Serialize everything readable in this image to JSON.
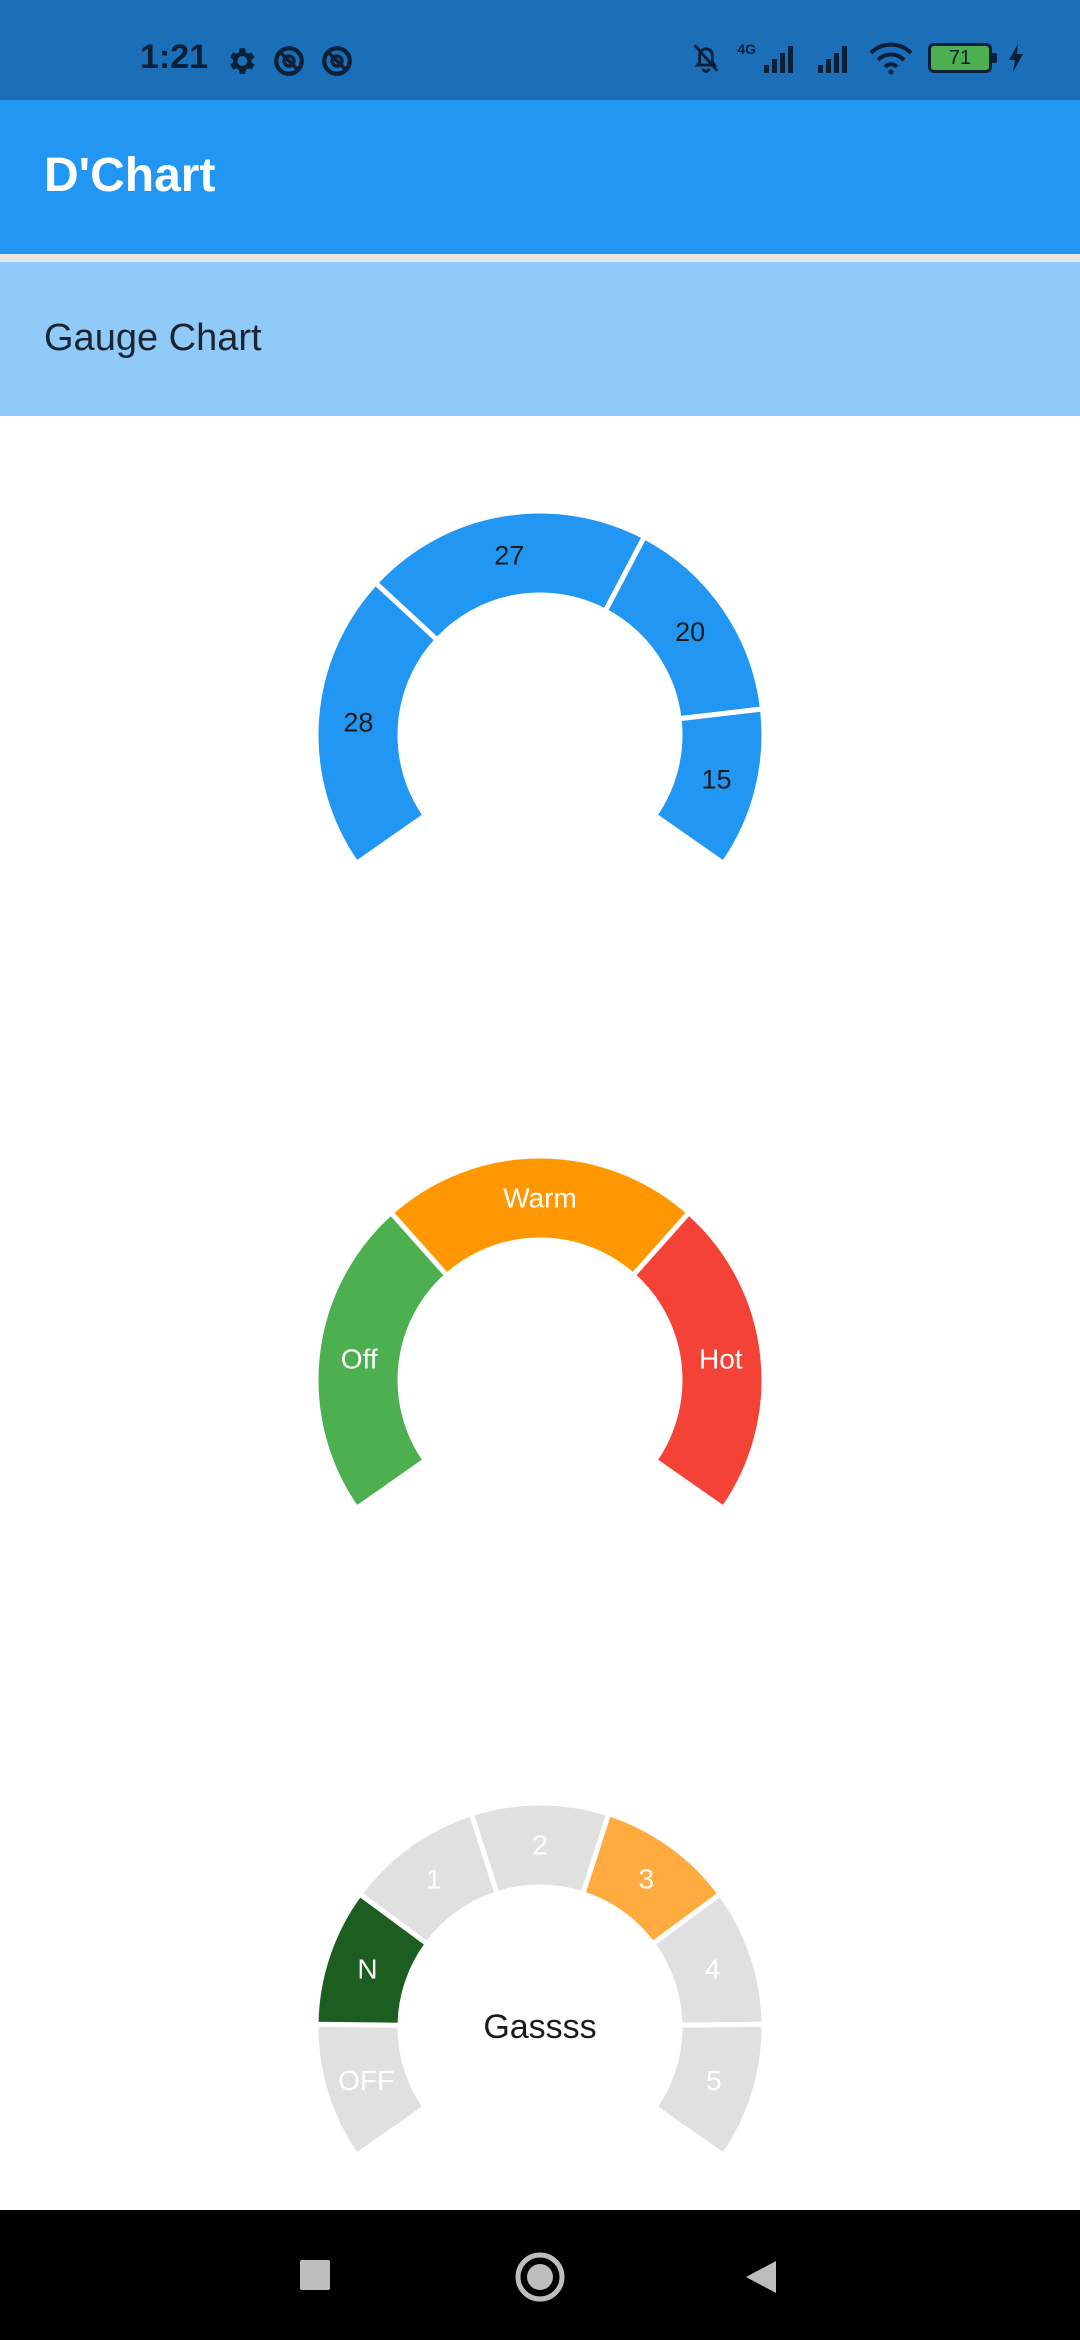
{
  "status_bar": {
    "time": "1:21",
    "battery_level": "71",
    "network_label": "4G",
    "icons": [
      "settings-icon",
      "sync-off-icon",
      "sync-off-icon",
      "mute-bell-icon",
      "signal-icon",
      "signal-icon",
      "wifi-icon",
      "battery-icon",
      "charging-icon"
    ]
  },
  "app_bar": {
    "title": "D'Chart"
  },
  "section": {
    "title": "Gauge Chart"
  },
  "chart_data": [
    {
      "type": "gauge",
      "segments": [
        {
          "label": "28",
          "value": 28,
          "color": "#2196f3"
        },
        {
          "label": "27",
          "value": 27,
          "color": "#2196f3"
        },
        {
          "label": "20",
          "value": 20,
          "color": "#2196f3"
        },
        {
          "label": "15",
          "value": 15,
          "color": "#2196f3"
        }
      ],
      "label_color": "#1b1b1b"
    },
    {
      "type": "gauge",
      "segments": [
        {
          "label": "Off",
          "value": 1,
          "color": "#4caf50"
        },
        {
          "label": "Warm",
          "value": 1,
          "color": "#ff9800"
        },
        {
          "label": "Hot",
          "value": 1,
          "color": "#f44336"
        }
      ],
      "label_color": "#ffffff"
    },
    {
      "type": "gauge",
      "center_label": "Gassss",
      "segments": [
        {
          "label": "OFF",
          "value": 1,
          "color": "#e0e0e0"
        },
        {
          "label": "N",
          "value": 1,
          "color": "#1b5e20"
        },
        {
          "label": "1",
          "value": 1,
          "color": "#e0e0e0"
        },
        {
          "label": "2",
          "value": 1,
          "color": "#e0e0e0"
        },
        {
          "label": "3",
          "value": 1,
          "color": "#ffab40"
        },
        {
          "label": "4",
          "value": 1,
          "color": "#e0e0e0"
        },
        {
          "label": "5",
          "value": 1,
          "color": "#e0e0e0"
        }
      ],
      "label_color": "#ffffff"
    }
  ],
  "nav_bar": {
    "icons": [
      "recents-square-icon",
      "home-circle-icon",
      "back-triangle-icon"
    ]
  }
}
